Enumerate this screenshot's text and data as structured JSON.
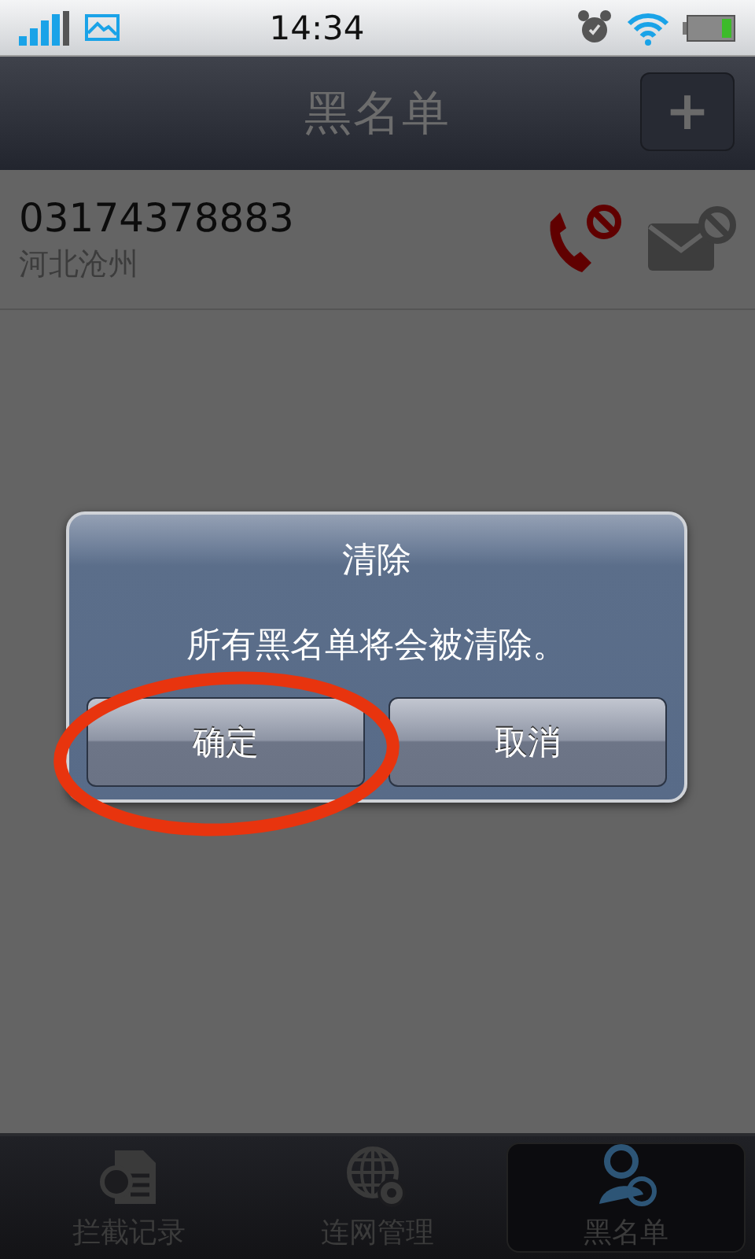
{
  "status_bar": {
    "time": "14:34"
  },
  "nav_bar": {
    "title": "黑名单",
    "add_button": "+"
  },
  "entries": [
    {
      "number": "03174378883",
      "location": "河北沧州"
    }
  ],
  "dialog": {
    "title": "清除",
    "message": "所有黑名单将会被清除。",
    "buttons": [
      {
        "label": "确定",
        "highlighted": true
      },
      {
        "label": "取消",
        "highlighted": false
      }
    ]
  },
  "tabs": [
    {
      "label": "拦截记录",
      "kind": "log",
      "selected": false
    },
    {
      "label": "连网管理",
      "kind": "network",
      "selected": false
    },
    {
      "label": "黑名单",
      "kind": "blacklist",
      "selected": true
    }
  ]
}
